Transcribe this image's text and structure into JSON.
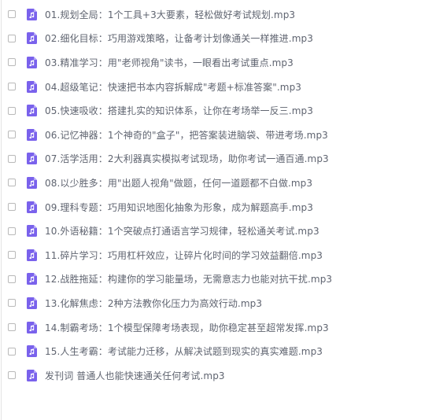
{
  "file_list": {
    "icon": "audio-file-icon",
    "accent_color": "#7a62ec",
    "items": [
      {
        "name": "01.规划全局：1个工具+3大要素，轻松做好考试规划.mp3"
      },
      {
        "name": "02.细化目标：巧用游戏策略，让备考计划像通关一样推进.mp3"
      },
      {
        "name": "03.精准学习：用\"老师视角\"读书，一眼看出考试重点.mp3"
      },
      {
        "name": "04.超级笔记：快速把书本内容拆解成\"考题+标准答案\".mp3"
      },
      {
        "name": "05.快速吸收：搭建扎实的知识体系，让你在考场举一反三.mp3"
      },
      {
        "name": "06.记忆神器：1个神奇的\"盒子\"，把答案装进脑袋、带进考场.mp3"
      },
      {
        "name": "07.活学活用：2大利器真实模拟考试现场，助你考试一通百通.mp3"
      },
      {
        "name": "08.以少胜多：用\"出题人视角\"做题，任何一道题都不白做.mp3"
      },
      {
        "name": "09.理科专题：巧用知识地图化抽象为形象，成为解题高手.mp3"
      },
      {
        "name": "10.外语秘籍：1个突破点打通语言学习规律，轻松通关考试.mp3"
      },
      {
        "name": "11.碎片学习：巧用杠杆效应，让碎片化时间的学习效益翻倍.mp3"
      },
      {
        "name": "12.战胜拖延：构建你的学习能量场，无需意志力也能对抗干扰.mp3"
      },
      {
        "name": "13.化解焦虑：2种方法教你化压力为高效行动.mp3"
      },
      {
        "name": "14.制霸考场：1个模型保障考场表现，助你稳定甚至超常发挥.mp3"
      },
      {
        "name": "15.人生考霸：考试能力迁移，从解决试题到现实的真实难题.mp3"
      },
      {
        "name": "发刊词 普通人也能快速通关任何考试.mp3"
      }
    ]
  }
}
